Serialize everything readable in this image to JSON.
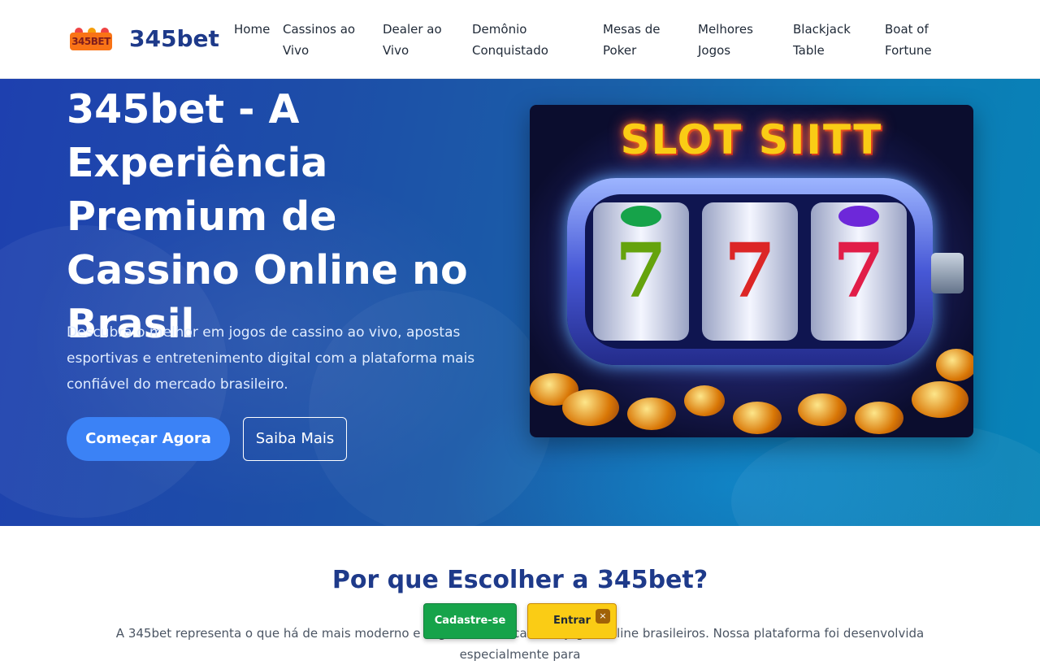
{
  "header": {
    "logo_badge": "345BET",
    "logo_text": "345bet",
    "nav": [
      {
        "label": "Home"
      },
      {
        "label": "Cassinos ao Vivo"
      },
      {
        "label": "Dealer ao Vivo"
      },
      {
        "label": "Demônio Conquistado"
      },
      {
        "label": "Mesas de Poker"
      },
      {
        "label": "Melhores Jogos"
      },
      {
        "label": "Blackjack Table"
      },
      {
        "label": "Boat of Fortune"
      }
    ]
  },
  "hero": {
    "title": "345bet - A Experiência Premium de Cassino Online no Brasil",
    "description": "Descubra o melhor em jogos de cassino ao vivo, apostas esportivas e entretenimento digital com a plataforma mais confiável do mercado brasileiro.",
    "primary_button": "Começar Agora",
    "secondary_button": "Saiba Mais",
    "image": {
      "slot_title": "SLOT SIITT",
      "reel_symbols": [
        "7",
        "7",
        "7"
      ]
    }
  },
  "section": {
    "title": "Por que Escolher a 345bet?",
    "text": "A 345bet representa o que há de mais moderno e seguro no mercado de jogos online brasileiros. Nossa plataforma foi desenvolvida especialmente para"
  },
  "floating_cta": {
    "register": "Cadastre-se",
    "login": "Entrar",
    "close": "×"
  },
  "colors": {
    "brand": "#1e3a8a",
    "primary_button": "#3b82f6",
    "register": "#16a34a",
    "login": "#facc15"
  }
}
